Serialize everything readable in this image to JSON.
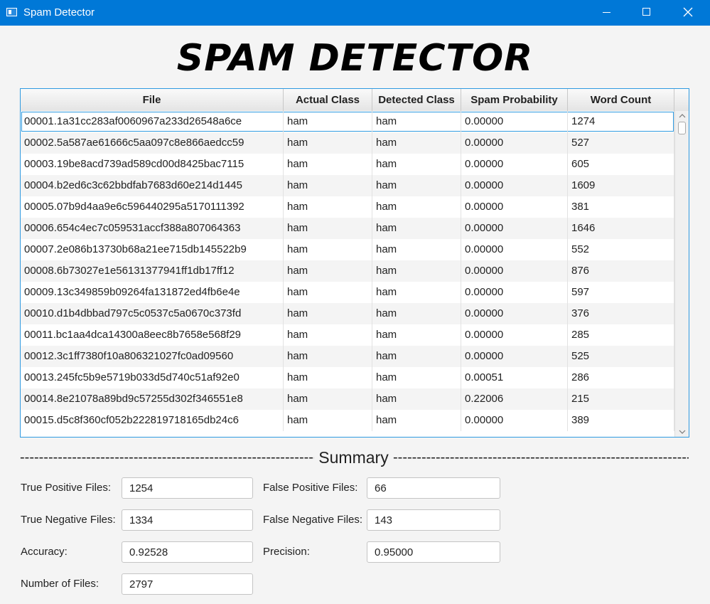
{
  "window": {
    "title": "Spam Detector"
  },
  "heading": "SPAM DETECTOR",
  "table": {
    "columns": [
      "File",
      "Actual Class",
      "Detected Class",
      "Spam Probability",
      "Word Count"
    ],
    "rows": [
      [
        "00001.1a31cc283af0060967a233d26548a6ce",
        "ham",
        "ham",
        "0.00000",
        "1274"
      ],
      [
        "00002.5a587ae61666c5aa097c8e866aedcc59",
        "ham",
        "ham",
        "0.00000",
        "527"
      ],
      [
        "00003.19be8acd739ad589cd00d8425bac7115",
        "ham",
        "ham",
        "0.00000",
        "605"
      ],
      [
        "00004.b2ed6c3c62bbdfab7683d60e214d1445",
        "ham",
        "ham",
        "0.00000",
        "1609"
      ],
      [
        "00005.07b9d4aa9e6c596440295a5170111392",
        "ham",
        "ham",
        "0.00000",
        "381"
      ],
      [
        "00006.654c4ec7c059531accf388a807064363",
        "ham",
        "ham",
        "0.00000",
        "1646"
      ],
      [
        "00007.2e086b13730b68a21ee715db145522b9",
        "ham",
        "ham",
        "0.00000",
        "552"
      ],
      [
        "00008.6b73027e1e56131377941ff1db17ff12",
        "ham",
        "ham",
        "0.00000",
        "876"
      ],
      [
        "00009.13c349859b09264fa131872ed4fb6e4e",
        "ham",
        "ham",
        "0.00000",
        "597"
      ],
      [
        "00010.d1b4dbbad797c5c0537c5a0670c373fd",
        "ham",
        "ham",
        "0.00000",
        "376"
      ],
      [
        "00011.bc1aa4dca14300a8eec8b7658e568f29",
        "ham",
        "ham",
        "0.00000",
        "285"
      ],
      [
        "00012.3c1ff7380f10a806321027fc0ad09560",
        "ham",
        "ham",
        "0.00000",
        "525"
      ],
      [
        "00013.245fc5b9e5719b033d5d740c51af92e0",
        "ham",
        "ham",
        "0.00051",
        "286"
      ],
      [
        "00014.8e21078a89bd9c57255d302f346551e8",
        "ham",
        "ham",
        "0.22006",
        "215"
      ],
      [
        "00015.d5c8f360cf052b222819718165db24c6",
        "ham",
        "ham",
        "0.00000",
        "389"
      ]
    ]
  },
  "summary": {
    "title": "Summary",
    "dashes_left": "--------------------------------------------------------------------------------------",
    "dashes_right": "--------------------------------------------------------------------------------------",
    "true_positive_label": "True Positive Files:",
    "true_positive_value": "1254",
    "false_positive_label": "False Positive Files:",
    "false_positive_value": "66",
    "true_negative_label": "True Negative Files:",
    "true_negative_value": "1334",
    "false_negative_label": "False Negative Files:",
    "false_negative_value": "143",
    "accuracy_label": "Accuracy:",
    "accuracy_value": "0.92528",
    "precision_label": "Precision:",
    "precision_value": "0.95000",
    "num_files_label": "Number of Files:",
    "num_files_value": "2797"
  },
  "colors": {
    "titlebar": "#0078d7",
    "selection": "#2f9ae0"
  },
  "icons": [
    "app-icon",
    "minimize-icon",
    "maximize-icon",
    "close-icon",
    "scroll-up-icon",
    "scroll-down-icon"
  ]
}
